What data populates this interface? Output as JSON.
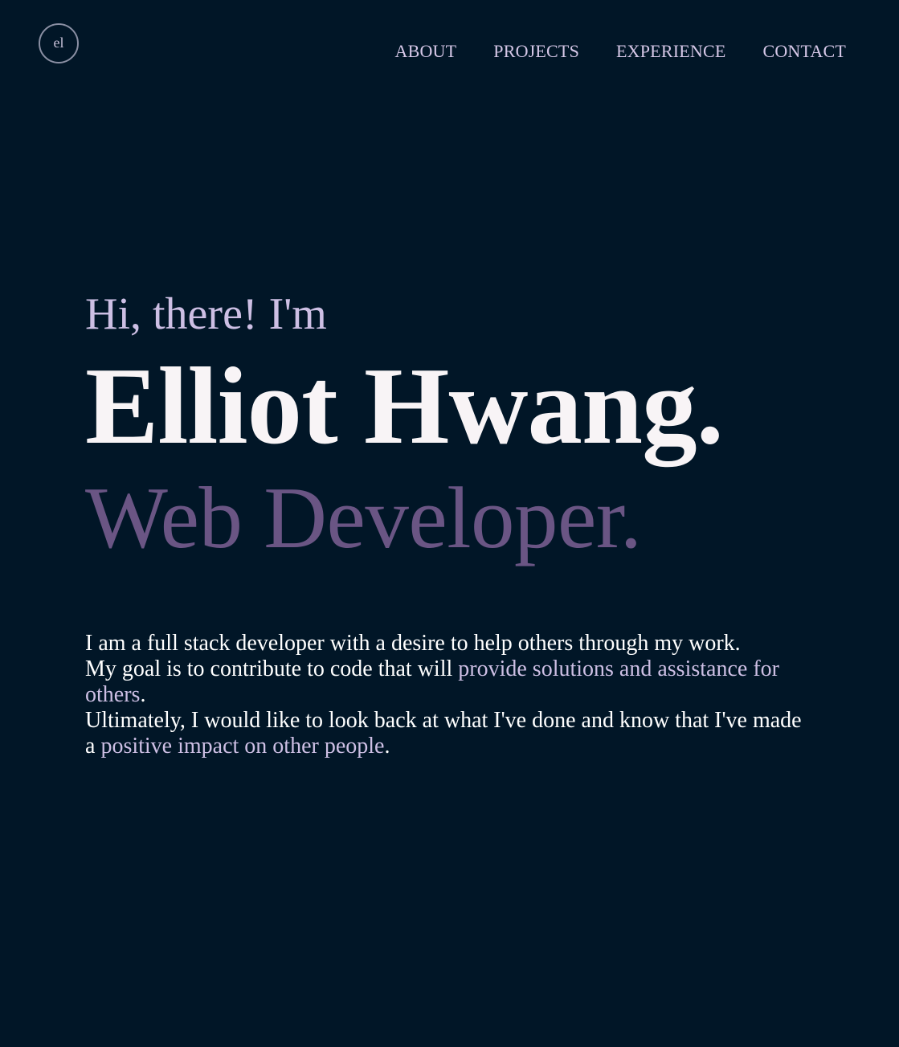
{
  "logo": {
    "text": "el"
  },
  "nav": {
    "items": [
      {
        "label": "ABOUT"
      },
      {
        "label": "PROJECTS"
      },
      {
        "label": "EXPERIENCE"
      },
      {
        "label": "CONTACT"
      }
    ]
  },
  "hero": {
    "greeting": "Hi, there! I'm",
    "name": "Elliot Hwang.",
    "role": "Web Developer."
  },
  "bio": {
    "line1": "I am a full stack developer with a desire to help others through my work.",
    "line2_pre": "My goal is to contribute to code that will ",
    "line2_highlight": "provide solutions and assistance for others",
    "line2_post": ".",
    "line3_pre": "Ultimately, I would like to look back at what I've done and know that I've made a ",
    "line3_highlight": "positive impact on other people",
    "line3_post": "."
  },
  "colors": {
    "background": "#011627",
    "nav_text": "#d6c8e8",
    "greeting": "#cdbfe4",
    "name": "#f8f4f6",
    "role": "#6a5584",
    "highlight": "#cdbfe4"
  }
}
